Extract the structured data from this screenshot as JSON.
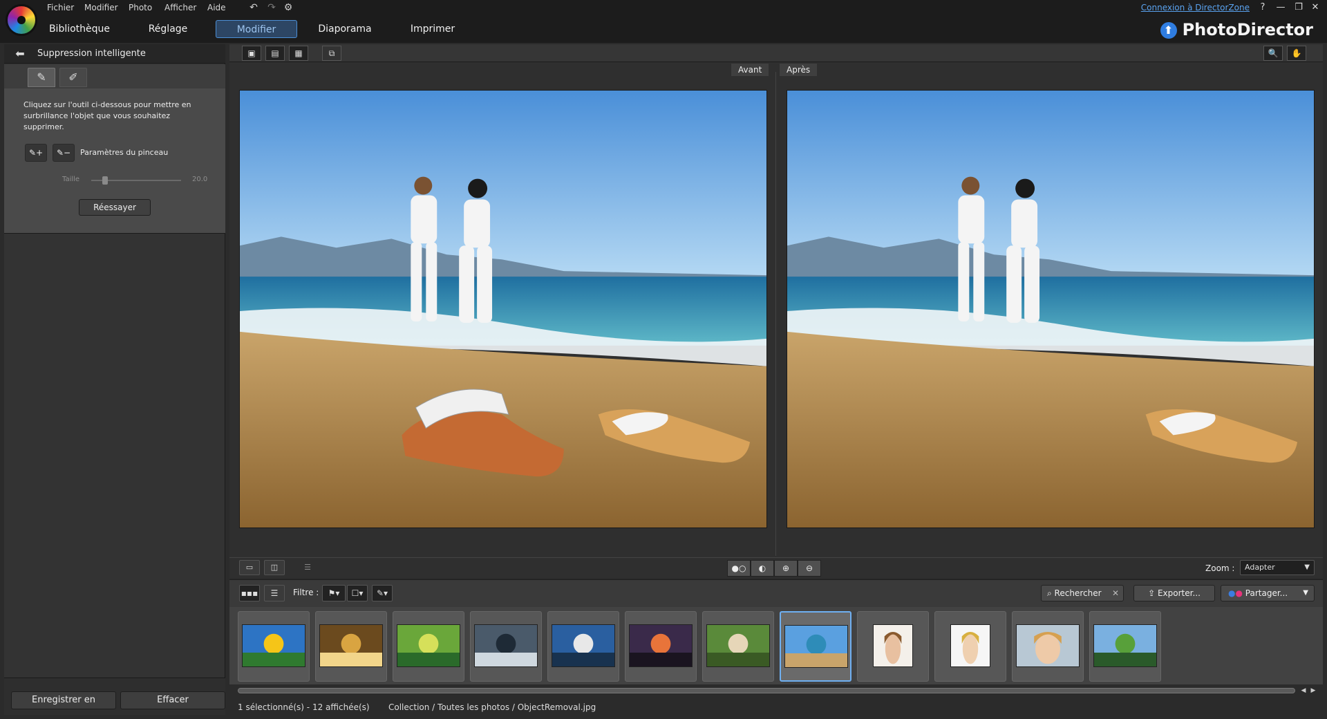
{
  "menu": [
    "Fichier",
    "Modifier",
    "Photo",
    "Afficher",
    "Aide"
  ],
  "nav_tabs": [
    {
      "label": "Bibliothèque",
      "active": false
    },
    {
      "label": "Réglage",
      "active": false
    },
    {
      "label": "Modifier",
      "active": true
    },
    {
      "label": "Diaporama",
      "active": false
    },
    {
      "label": "Imprimer",
      "active": false
    }
  ],
  "brand": "PhotoDirector",
  "directorzone_link": "Connexion à DirectorZone",
  "window_buttons": [
    "?",
    "—",
    "❐",
    "✕"
  ],
  "left_panel": {
    "title": "Suppression intelligente",
    "instructions": "Cliquez sur l'outil ci-dessous pour mettre en surbrillance l'objet que vous souhaitez supprimer.",
    "brush_settings_label": "Paramètres du pinceau",
    "size_label": "Taille",
    "size_value": "20.0",
    "size_fraction": 0.15,
    "retry_label": "Réessayer",
    "save_label": "Enregistrer en",
    "clear_label": "Effacer"
  },
  "viewer": {
    "before_label": "Avant",
    "after_label": "Après",
    "zoom_label": "Zoom :",
    "zoom_value": "Adapter"
  },
  "filmstrip": {
    "filter_label": "Filtre :",
    "search_placeholder": "Rechercher",
    "export_label": "Exporter...",
    "share_label": "Partager...",
    "thumbnails": [
      "sunflower",
      "spiral-shell",
      "bicycle-field",
      "coastal-rocks",
      "lake-mountains",
      "sunset-clouds",
      "cat-grass",
      "beach-couple",
      "woman-portrait-1",
      "woman-portrait-2",
      "woman-portrait-3",
      "meadow-landscape"
    ],
    "selected_index": 7
  },
  "status": {
    "count": "1 sélectionné(s) - 12 affichée(s)",
    "path": "Collection / Toutes les photos / ObjectRemoval.jpg"
  },
  "colors": {
    "accent": "#4c8fd6",
    "link": "#5aa3f0",
    "selected_thumb_border": "#6fb0f2"
  }
}
